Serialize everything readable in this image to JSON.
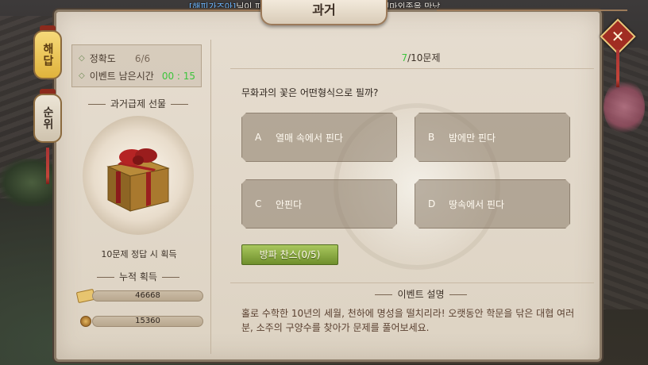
{
  "ticker": {
    "name": "[해피가즈아]",
    "message": "님이 파티원들과 악탈마적을 제거할 때, 백마외종을 만났"
  },
  "title": "과거",
  "tabs": {
    "answer": "해답",
    "rank": "순위"
  },
  "close_label": "✕",
  "stats": {
    "accuracy_label": "정확도",
    "accuracy_value": "6/6",
    "time_label": "이벤트 남은시간",
    "time_value": "00 : 15"
  },
  "gift": {
    "heading": "과거급제 선물",
    "caption": "10문제 정답 시 획득"
  },
  "accumulated": {
    "heading": "누적 획득",
    "items": [
      {
        "icon": "scroll-icon",
        "value": "46668"
      },
      {
        "icon": "coin-icon",
        "value": "15360"
      }
    ]
  },
  "question": {
    "current": "7",
    "total_label": "/10문제",
    "text": "무화과의 꽃은 어떤형식으로 필까?",
    "answers": [
      {
        "letter": "A",
        "text": "열매 속에서 핀다"
      },
      {
        "letter": "B",
        "text": "밤에만 핀다"
      },
      {
        "letter": "C",
        "text": "안핀다"
      },
      {
        "letter": "D",
        "text": "땅속에서 핀다"
      }
    ]
  },
  "chance_button": "방파 찬스(0/5)",
  "event": {
    "heading": "이벤트 설명",
    "text": "홀로 수학한 10년의 세월, 천하에 명성을 떨치리라! 오랫동안 학문을 닦은 대협 여러분, 소주의 구양수를 찾아가 문제를 풀어보세요."
  },
  "colors": {
    "accent_green": "#3cc43c",
    "close_red": "#a12d22",
    "button_green": "#8aaa44"
  }
}
